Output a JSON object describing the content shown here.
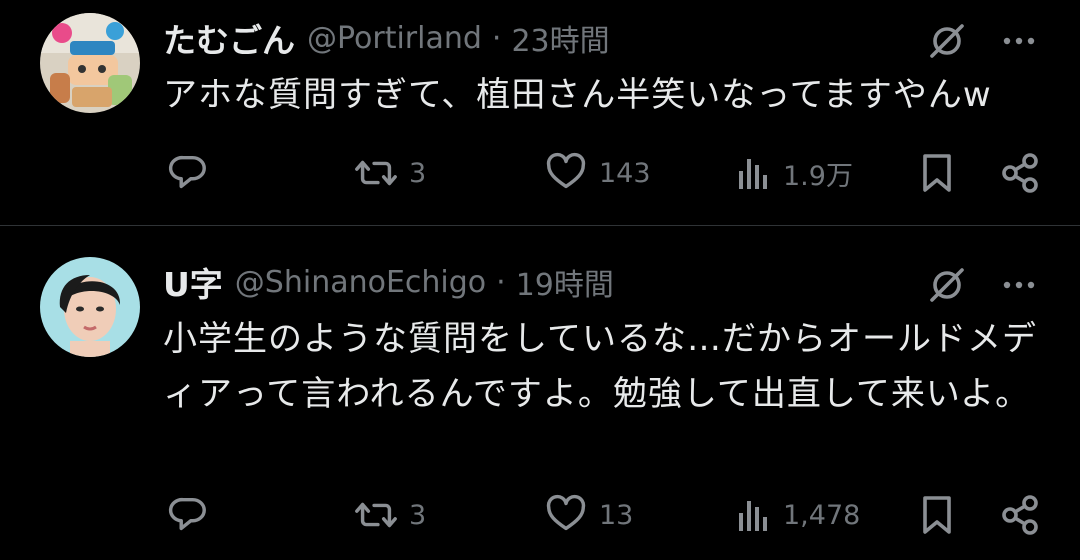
{
  "tweets": [
    {
      "author_name": "たむごん",
      "handle": "@Portirland",
      "separator": "·",
      "time": "23時間",
      "text": "アホな質問すぎて、植田さん半笑いなってますやんw",
      "replies": "",
      "retweets": "3",
      "likes": "143",
      "views": "1.9万"
    },
    {
      "author_name": "U字",
      "handle": "@ShinanoEchigo",
      "separator": "·",
      "time": "19時間",
      "text": "小学生のような質問をしているな…だからオールドメディアって言われるんですよ。勉強して出直して来いよ。",
      "replies": "",
      "retweets": "3",
      "likes": "13",
      "views": "1,478"
    }
  ],
  "icons": {
    "reply": "reply-icon",
    "retweet": "retweet-icon",
    "like": "heart-icon",
    "views": "views-icon",
    "bookmark": "bookmark-icon",
    "share": "share-icon",
    "grok": "grok-icon",
    "more": "more-icon"
  },
  "colors": {
    "background": "#000000",
    "primary_text": "#e7e9ea",
    "secondary_text": "#71767b",
    "divider": "#2f3336"
  }
}
